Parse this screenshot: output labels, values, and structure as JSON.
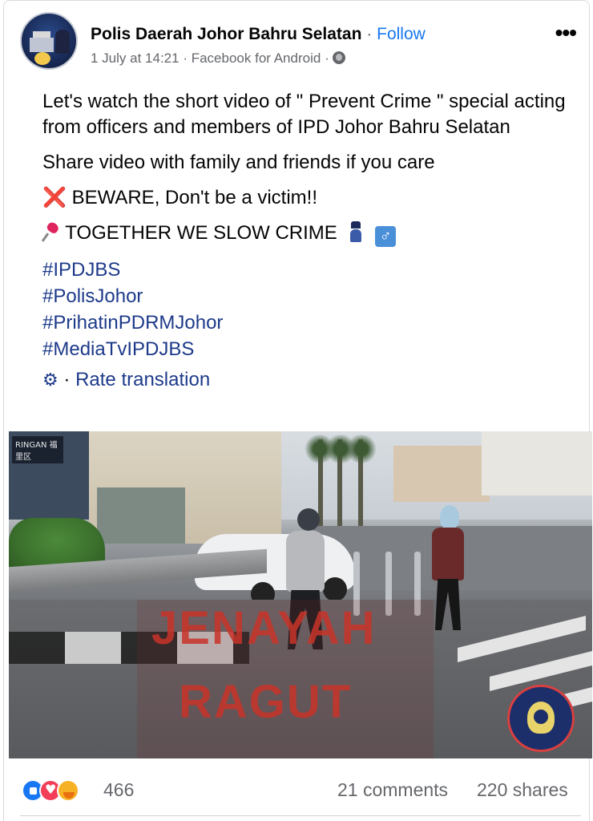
{
  "header": {
    "page_name": "Polis Daerah Johor Bahru Selatan",
    "separator": "·",
    "follow_label": "Follow",
    "timestamp": "1 July at 14:21",
    "meta_separator": "·",
    "source": "Facebook for Android",
    "audience_icon": "globe-icon",
    "more_icon": "more-horizontal-icon",
    "more_label": "•••"
  },
  "post": {
    "paragraph1": "Let's watch the short video of \" Prevent Crime \" special acting from officers and members of IPD Johor Bahru Selatan",
    "paragraph2": "Share video with family and friends if you care",
    "beware_icon": "❌",
    "beware_text": "BEWARE, Don't be a victim!!",
    "together_text": "TOGETHER WE SLOW CRIME",
    "male_symbol": "♂",
    "hashtags": [
      "#IPDJBS",
      "#PolisJohor",
      "#PrihatinPDRMJohor",
      "#MediaTvIPDJBS"
    ],
    "rate_icon": "⚙",
    "rate_separator": "·",
    "rate_label": "Rate translation"
  },
  "video": {
    "title_line1": "JENAYAH",
    "title_line2": "RAGUT",
    "shop_sign": "RINGAN 福里区"
  },
  "stats": {
    "reaction_count": "466",
    "comments": "21 comments",
    "shares": "220 shares"
  },
  "colors": {
    "link_blue": "#1877f2",
    "hashtag": "#1d3a8a",
    "muted": "#65676b",
    "like": "#1877f2",
    "love": "#f33e58",
    "care": "#f7b125"
  }
}
